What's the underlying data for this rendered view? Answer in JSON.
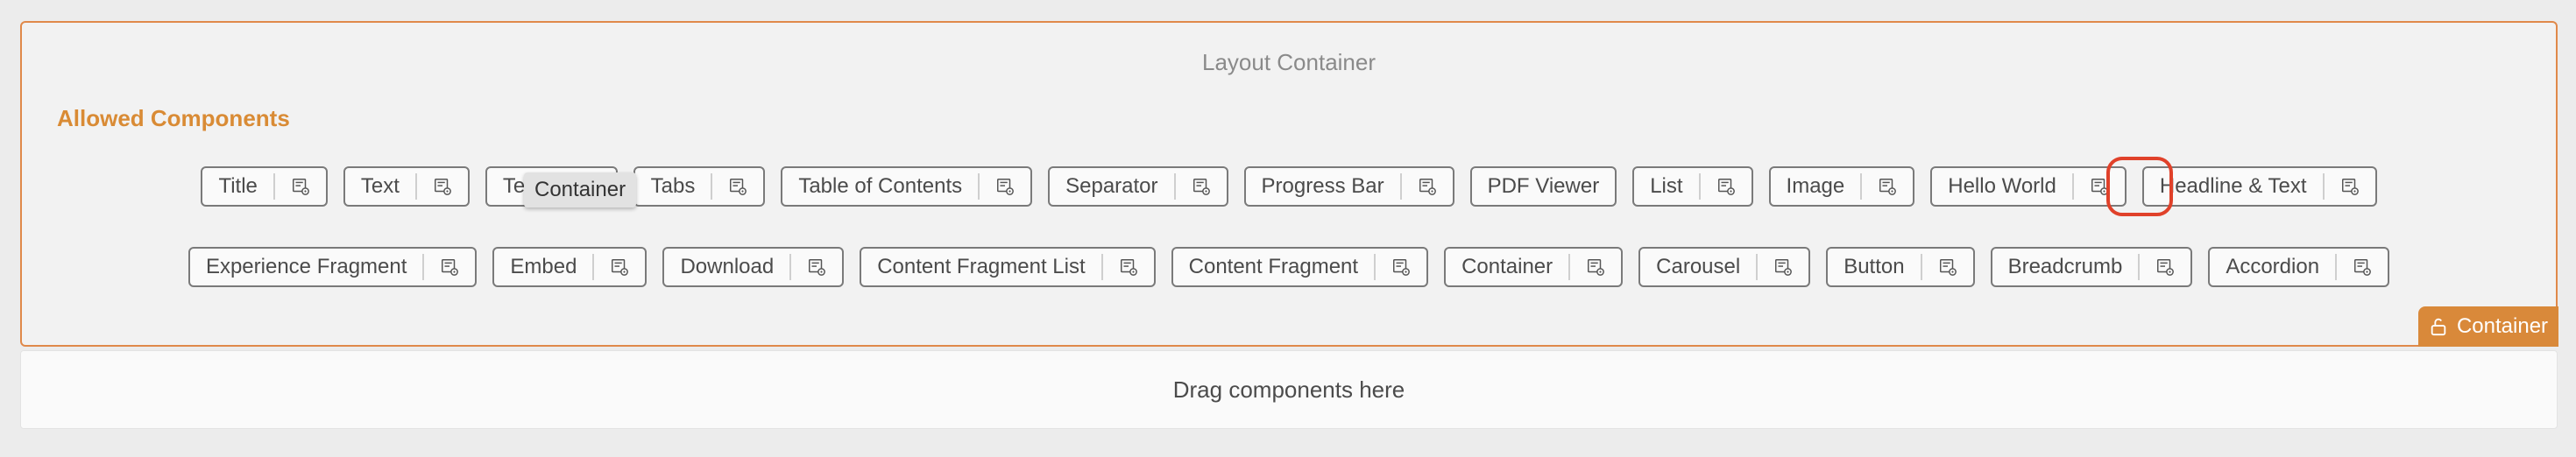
{
  "panel": {
    "title": "Layout Container",
    "allowed_heading": "Allowed Components",
    "row1": [
      {
        "label": "Title",
        "has_action": true
      },
      {
        "label": "Text",
        "has_action": true
      },
      {
        "label": "Teas",
        "has_action": true
      },
      {
        "label": "Tabs",
        "has_action": true
      },
      {
        "label": "Table of Contents",
        "has_action": true
      },
      {
        "label": "Separator",
        "has_action": true
      },
      {
        "label": "Progress Bar",
        "has_action": true
      },
      {
        "label": "PDF Viewer",
        "has_action": false
      },
      {
        "label": "List",
        "has_action": true
      },
      {
        "label": "Image",
        "has_action": true
      },
      {
        "label": "Hello World",
        "has_action": true
      },
      {
        "label": "Headline & Text",
        "has_action": true
      }
    ],
    "row2": [
      {
        "label": "Experience Fragment",
        "has_action": true
      },
      {
        "label": "Embed",
        "has_action": true
      },
      {
        "label": "Download",
        "has_action": true
      },
      {
        "label": "Content Fragment List",
        "has_action": true
      },
      {
        "label": "Content Fragment",
        "has_action": true
      },
      {
        "label": "Container",
        "has_action": true
      },
      {
        "label": "Carousel",
        "has_action": true
      },
      {
        "label": "Button",
        "has_action": true
      },
      {
        "label": "Breadcrumb",
        "has_action": true
      },
      {
        "label": "Accordion",
        "has_action": true
      }
    ],
    "tooltip": "Container",
    "badge": "Container"
  },
  "dropzone": {
    "text": "Drag components here"
  },
  "colors": {
    "accent": "#d9893a",
    "highlight": "#e0412a"
  },
  "icons": {
    "chip_action": "policy-settings-icon",
    "badge": "unlock-icon"
  }
}
